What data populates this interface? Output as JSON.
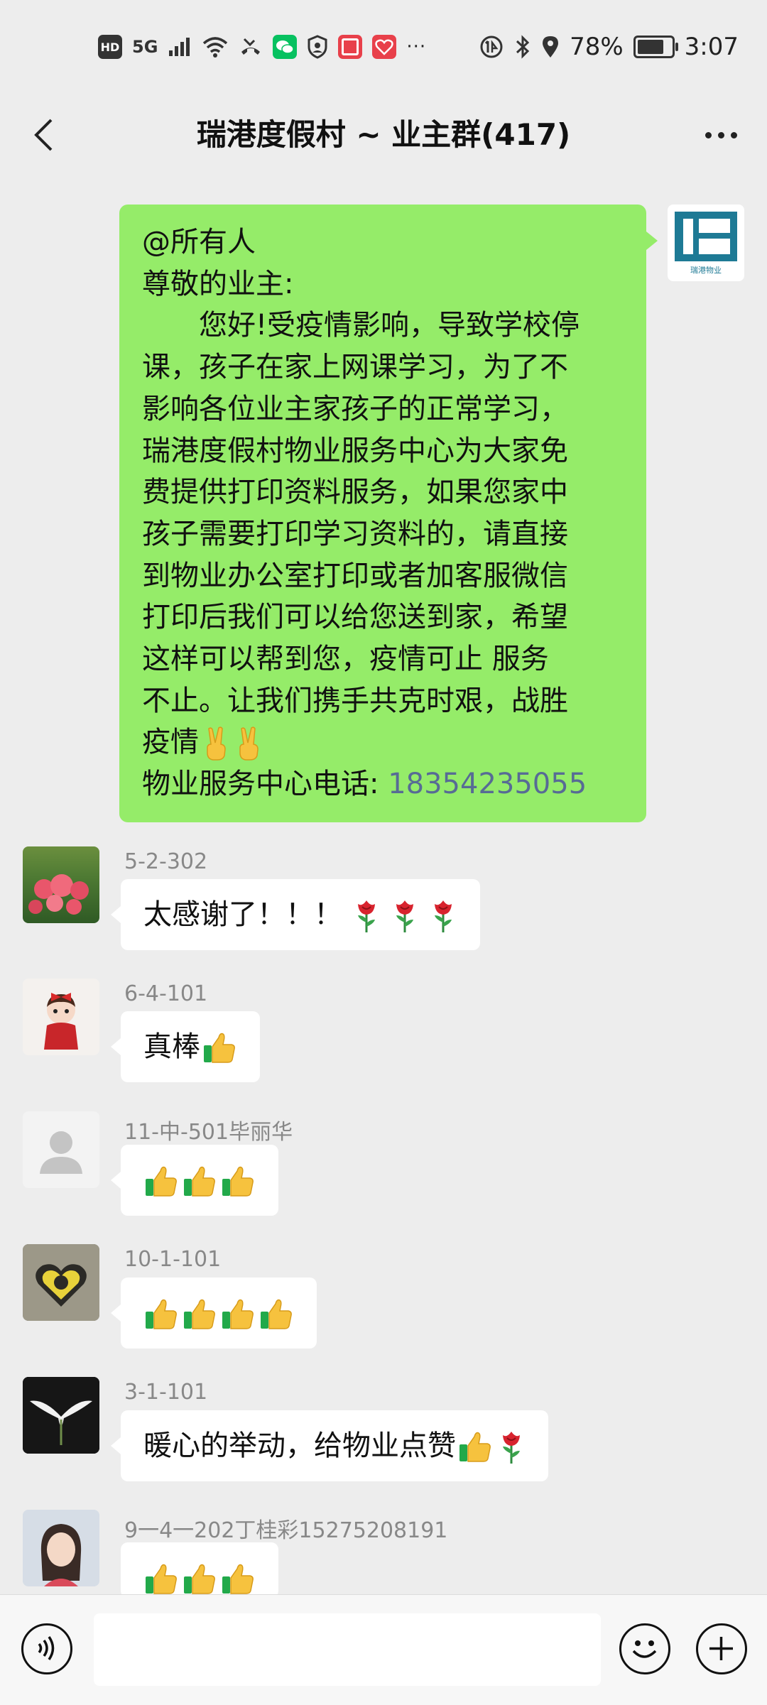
{
  "status_bar": {
    "hd": "HD",
    "network": "5G",
    "battery": "78%",
    "time": "3:07",
    "battery_level": 0.78,
    "icons": [
      "wifi-icon",
      "missed-call-icon",
      "wechat-icon",
      "shield-icon",
      "app-red-icon",
      "app-pattern-icon",
      "more-dots-icon",
      "data-saver-icon",
      "bluetooth-icon",
      "location-icon"
    ]
  },
  "header": {
    "title": "瑞港度假村 ~ 业主群(417)",
    "back_icon": "chevron-left-icon",
    "more_icon": "more-icon"
  },
  "announcement": {
    "lines": [
      "@所有人",
      "尊敬的业主:",
      "　　您好!受疫情影响，导致学校停",
      "课，孩子在家上网课学习，为了不",
      "影响各位业主家孩子的正常学习，",
      "瑞港度假村物业服务中心为大家免",
      "费提供打印资料服务，如果您家中",
      "孩子需要打印学习资料的，请直接",
      "到物业办公室打印或者加客服微信",
      "打印后我们可以给您送到家，希望",
      "这样可以帮到您，疫情可止 服务",
      "不止。让我们携手共克时艰，战胜",
      "疫情"
    ],
    "phone_label": "物业服务中心电话:",
    "phone": "18354235055",
    "emoji_end": "victory-hand-icon x2",
    "sender_avatar_text": "瑞港物业"
  },
  "messages": [
    {
      "sender": "5-2-302",
      "text": "太感谢了！！！",
      "emoji": "rose-icon x3"
    },
    {
      "sender": "6-4-101",
      "text": "真棒",
      "emoji": "thumbs-up-icon"
    },
    {
      "sender": "11-中-501毕丽华",
      "text": "",
      "emoji": "thumbs-up-icon x3"
    },
    {
      "sender": "10-1-101",
      "text": "",
      "emoji": "thumbs-up-icon x4"
    },
    {
      "sender": "3-1-101",
      "text": "暖心的举动，给物业点赞",
      "emoji": "thumbs-up-icon, rose-icon"
    },
    {
      "sender": "9一4一202丁桂彩15275208191",
      "text": "",
      "emoji": "thumbs-up-icon x3"
    }
  ],
  "input_bar": {
    "voice_icon": "voice-icon",
    "emoji_icon": "emoji-icon",
    "add_icon": "add-icon",
    "input_value": ""
  }
}
